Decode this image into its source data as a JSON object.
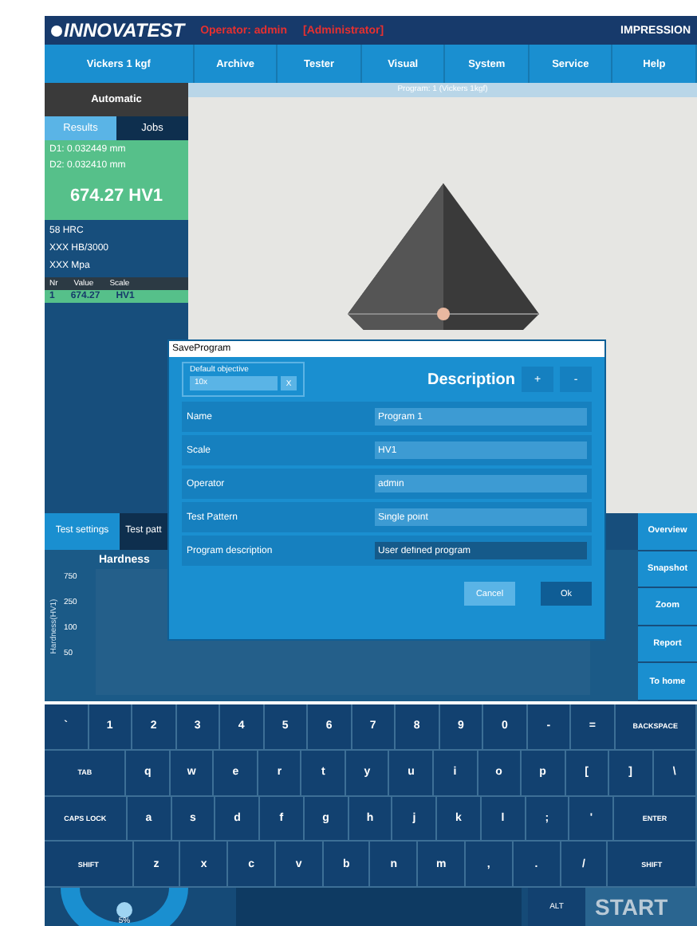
{
  "header": {
    "logo": "INNOVATEST",
    "operator": "Operator: admin",
    "role": "[Administrator]",
    "product": "IMPRESSION"
  },
  "menu": [
    "Vickers 1 kgf",
    "Archive",
    "Tester",
    "Visual",
    "System",
    "Service",
    "Help"
  ],
  "mode": "Automatic",
  "result_tabs": [
    {
      "label": "Results",
      "selected": true
    },
    {
      "label": "Jobs",
      "selected": false
    }
  ],
  "measurements": [
    "D1: 0.032449 mm",
    "D2: 0.032410 mm"
  ],
  "hardness": "674.27 HV1",
  "conversions": [
    "58 HRC",
    "XXX HB/3000",
    "XXX Mpa"
  ],
  "results_table": {
    "columns": [
      "Nr",
      "Value",
      "Scale"
    ],
    "rows": [
      [
        "1",
        "674.27",
        "HV1"
      ]
    ]
  },
  "image_caption": "Program: 1 (Vickers 1kgf)",
  "bottom_tabs": [
    {
      "label": "Test settings",
      "selected": true
    },
    {
      "label": "Test patt",
      "selected": false
    }
  ],
  "chart": {
    "title": "Hardness",
    "ylabel": "Hardness(HV1)",
    "yticks": [
      "750",
      "250",
      "100",
      "50"
    ]
  },
  "side_buttons": [
    "Overview",
    "Snapshot",
    "Zoom",
    "Report",
    "To home"
  ],
  "dialog": {
    "title": "SaveProgram",
    "group_label": "Default objective",
    "objective": "10x",
    "clear": "X",
    "description": "Description",
    "add": "+",
    "remove": "-",
    "fields": [
      {
        "label": "Name",
        "value": "Program 1",
        "kind": "input"
      },
      {
        "label": "Scale",
        "value": "HV1",
        "kind": "input"
      },
      {
        "label": "Operator",
        "value": "admin",
        "kind": "input"
      },
      {
        "label": "Test Pattern",
        "value": "Single point",
        "kind": "input"
      },
      {
        "label": "Program description",
        "value": "User defined program",
        "kind": "readonly"
      }
    ],
    "buttons": [
      {
        "label": "Cancel",
        "kind": "primary"
      },
      {
        "label": "Ok",
        "kind": "secondary"
      }
    ]
  },
  "keyboard": [
    [
      "`",
      "1",
      "2",
      "3",
      "4",
      "5",
      "6",
      "7",
      "8",
      "9",
      "0",
      "-",
      "=",
      "BACKSPACE"
    ],
    [
      "TAB",
      "q",
      "w",
      "e",
      "r",
      "t",
      "y",
      "u",
      "i",
      "o",
      "p",
      "[",
      "]",
      "\\"
    ],
    [
      "CAPS LOCK",
      "a",
      "s",
      "d",
      "f",
      "g",
      "h",
      "j",
      "k",
      "l",
      ";",
      "'",
      "ENTER"
    ],
    [
      "SHIFT",
      "z",
      "x",
      "c",
      "v",
      "b",
      "n",
      "m",
      ",",
      ".",
      "/",
      "SHIFT"
    ]
  ],
  "dial": {
    "label": "5%",
    "level": 0.5
  },
  "alt_key": "ALT",
  "start": "START"
}
